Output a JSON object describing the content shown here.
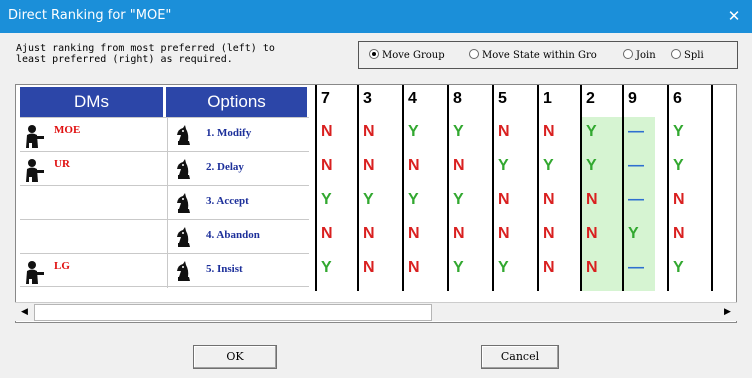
{
  "window": {
    "title": "Direct Ranking for \"MOE\"",
    "close_glyph": "✕"
  },
  "instruction": "Ajust ranking from most preferred (left) to\nleast preferred (right) as required.",
  "modes": [
    {
      "label": "Move Group",
      "selected": true
    },
    {
      "label": "Move State within Gro",
      "selected": false
    },
    {
      "label": "Join",
      "selected": false
    },
    {
      "label": "Spli",
      "selected": false
    }
  ],
  "headers": {
    "dms": "DMs",
    "options": "Options"
  },
  "dms": [
    {
      "name": "MOE",
      "icon": "person-icon"
    },
    {
      "name": "UR",
      "icon": "person-icon"
    },
    {
      "name": "",
      "icon": ""
    },
    {
      "name": "",
      "icon": ""
    },
    {
      "name": "LG",
      "icon": "person-icon"
    }
  ],
  "options": [
    {
      "label": "1. Modify",
      "icon": "chess-knight-icon"
    },
    {
      "label": "2. Delay",
      "icon": "chess-knight-icon"
    },
    {
      "label": "3. Accept",
      "icon": "chess-knight-icon"
    },
    {
      "label": "4. Abandon",
      "icon": "chess-knight-icon"
    },
    {
      "label": "5. Insist",
      "icon": "chess-knight-icon"
    }
  ],
  "states": [
    "7",
    "3",
    "4",
    "8",
    "5",
    "1",
    "2",
    "9",
    "6"
  ],
  "highlighted_group": [
    "2",
    "9"
  ],
  "matrix": [
    [
      "N",
      "N",
      "Y",
      "Y",
      "N",
      "N",
      "Y",
      "—",
      "Y"
    ],
    [
      "N",
      "N",
      "N",
      "N",
      "Y",
      "Y",
      "Y",
      "—",
      "Y"
    ],
    [
      "Y",
      "Y",
      "Y",
      "Y",
      "N",
      "N",
      "N",
      "—",
      "N"
    ],
    [
      "N",
      "N",
      "N",
      "N",
      "N",
      "N",
      "N",
      "Y",
      "N"
    ],
    [
      "Y",
      "N",
      "N",
      "Y",
      "Y",
      "N",
      "N",
      "—",
      "Y"
    ]
  ],
  "colors": {
    "N": "#d92020",
    "Y": "#32a830",
    "dash": "#2f6fd0",
    "header_bg": "#2c46a8",
    "highlight": "#d6f4d2"
  },
  "scrollbar": {
    "left_glyph": "◀",
    "right_glyph": "▶"
  },
  "buttons": {
    "ok": "OK",
    "cancel": "Cancel"
  }
}
